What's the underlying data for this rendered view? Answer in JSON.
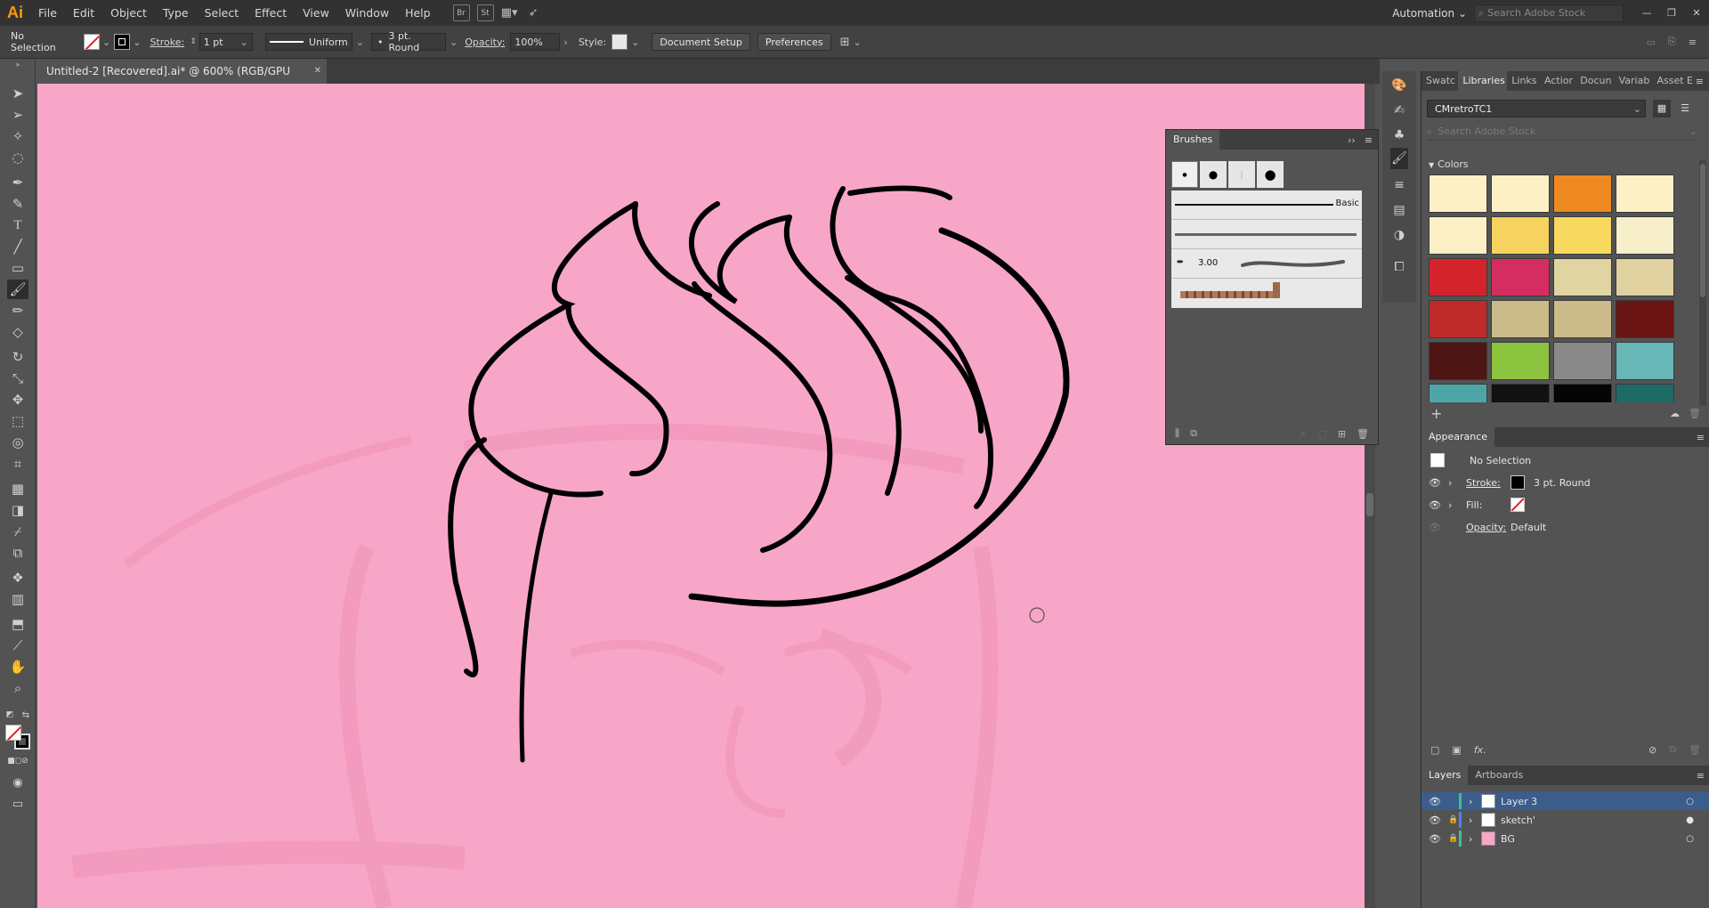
{
  "app": {
    "logo": "Ai",
    "workspace": "Automation",
    "stock_search_placeholder": "Search Adobe Stock"
  },
  "menu": [
    "File",
    "Edit",
    "Object",
    "Type",
    "Select",
    "Effect",
    "View",
    "Window",
    "Help"
  ],
  "menu_icons": {
    "bridge": "Br",
    "stock": "St"
  },
  "control": {
    "selection": "No Selection",
    "stroke_label": "Stroke:",
    "stroke_weight": "1 pt",
    "profile": "Uniform",
    "brush": "3 pt. Round",
    "opacity_label": "Opacity:",
    "opacity": "100%",
    "style_label": "Style:",
    "document_setup": "Document Setup",
    "preferences": "Preferences"
  },
  "document": {
    "tab_title": "Untitled-2 [Recovered].ai* @ 600% (RGB/GPU Preview)",
    "close_glyph": "✕"
  },
  "brushes": {
    "title": "Brushes",
    "rows": [
      {
        "label": "Basic"
      },
      {
        "label": ""
      },
      {
        "label": "3.00"
      },
      {
        "label": ""
      }
    ]
  },
  "libraries": {
    "tabs": [
      "Swatc",
      "Libraries",
      "Links",
      "Actior",
      "Docun",
      "Variab",
      "Asset E"
    ],
    "active_tab": "Libraries",
    "library_name": "CMretroTC1",
    "search_placeholder": "Search Adobe Stock",
    "colors_heading": "Colors",
    "colors": [
      "#fdf0c4",
      "#fdf0c4",
      "#ef8a22",
      "#fdf0c4",
      "#fcefc6",
      "#f6d35e",
      "#f8d85f",
      "#f7efc9",
      "#d5232c",
      "#d42d62",
      "#e0d4a3",
      "#e0d1a1",
      "#bf2a2a",
      "#cbbb8a",
      "#cbbb8a",
      "#6b1414",
      "#4e1515",
      "#8cc43f",
      "#8a8a8a",
      "#66b7b5",
      "#4ca6a8",
      "#111111",
      "#050505",
      "#1c6b67",
      "#0e3c3a",
      "#0a5e9c",
      "#7c3f68",
      "#fedba6",
      "#1a1a1a",
      "#e21f8c",
      "#4a2b3a",
      "#fde2a6"
    ]
  },
  "appearance": {
    "title": "Appearance",
    "selection": "No Selection",
    "stroke_label": "Stroke:",
    "stroke_value": "3 pt. Round",
    "fill_label": "Fill:",
    "opacity_label": "Opacity:",
    "opacity_value": "Default"
  },
  "layers": {
    "tabs": [
      "Layers",
      "Artboards"
    ],
    "items": [
      {
        "name": "Layer 3",
        "color": "#3fbf8f",
        "selected": true
      },
      {
        "name": "sketch'",
        "color": "#4f7fff",
        "selected": false
      },
      {
        "name": "BG",
        "color": "#3fbf8f",
        "selected": false
      }
    ]
  },
  "colors": {
    "artboard": "#f7a6c7",
    "accent": "#2f5f9e"
  }
}
